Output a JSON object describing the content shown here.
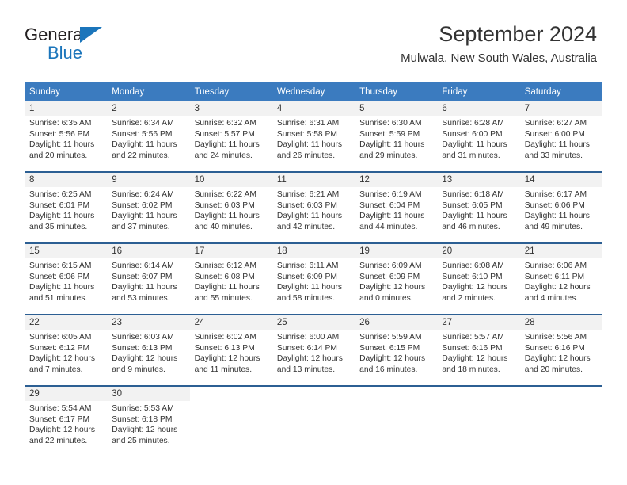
{
  "brand": {
    "name_part1": "General",
    "name_part2": "Blue",
    "accent_color": "#1b75bb"
  },
  "header": {
    "title": "September 2024",
    "subtitle": "Mulwala, New South Wales, Australia"
  },
  "calendar": {
    "header_bg": "#3b7bbf",
    "daynum_bg": "#f2f2f2",
    "weekdays": [
      "Sunday",
      "Monday",
      "Tuesday",
      "Wednesday",
      "Thursday",
      "Friday",
      "Saturday"
    ],
    "weeks": [
      [
        {
          "day": "1",
          "sunrise": "Sunrise: 6:35 AM",
          "sunset": "Sunset: 5:56 PM",
          "daylight_line1": "Daylight: 11 hours",
          "daylight_line2": "and 20 minutes."
        },
        {
          "day": "2",
          "sunrise": "Sunrise: 6:34 AM",
          "sunset": "Sunset: 5:56 PM",
          "daylight_line1": "Daylight: 11 hours",
          "daylight_line2": "and 22 minutes."
        },
        {
          "day": "3",
          "sunrise": "Sunrise: 6:32 AM",
          "sunset": "Sunset: 5:57 PM",
          "daylight_line1": "Daylight: 11 hours",
          "daylight_line2": "and 24 minutes."
        },
        {
          "day": "4",
          "sunrise": "Sunrise: 6:31 AM",
          "sunset": "Sunset: 5:58 PM",
          "daylight_line1": "Daylight: 11 hours",
          "daylight_line2": "and 26 minutes."
        },
        {
          "day": "5",
          "sunrise": "Sunrise: 6:30 AM",
          "sunset": "Sunset: 5:59 PM",
          "daylight_line1": "Daylight: 11 hours",
          "daylight_line2": "and 29 minutes."
        },
        {
          "day": "6",
          "sunrise": "Sunrise: 6:28 AM",
          "sunset": "Sunset: 6:00 PM",
          "daylight_line1": "Daylight: 11 hours",
          "daylight_line2": "and 31 minutes."
        },
        {
          "day": "7",
          "sunrise": "Sunrise: 6:27 AM",
          "sunset": "Sunset: 6:00 PM",
          "daylight_line1": "Daylight: 11 hours",
          "daylight_line2": "and 33 minutes."
        }
      ],
      [
        {
          "day": "8",
          "sunrise": "Sunrise: 6:25 AM",
          "sunset": "Sunset: 6:01 PM",
          "daylight_line1": "Daylight: 11 hours",
          "daylight_line2": "and 35 minutes."
        },
        {
          "day": "9",
          "sunrise": "Sunrise: 6:24 AM",
          "sunset": "Sunset: 6:02 PM",
          "daylight_line1": "Daylight: 11 hours",
          "daylight_line2": "and 37 minutes."
        },
        {
          "day": "10",
          "sunrise": "Sunrise: 6:22 AM",
          "sunset": "Sunset: 6:03 PM",
          "daylight_line1": "Daylight: 11 hours",
          "daylight_line2": "and 40 minutes."
        },
        {
          "day": "11",
          "sunrise": "Sunrise: 6:21 AM",
          "sunset": "Sunset: 6:03 PM",
          "daylight_line1": "Daylight: 11 hours",
          "daylight_line2": "and 42 minutes."
        },
        {
          "day": "12",
          "sunrise": "Sunrise: 6:19 AM",
          "sunset": "Sunset: 6:04 PM",
          "daylight_line1": "Daylight: 11 hours",
          "daylight_line2": "and 44 minutes."
        },
        {
          "day": "13",
          "sunrise": "Sunrise: 6:18 AM",
          "sunset": "Sunset: 6:05 PM",
          "daylight_line1": "Daylight: 11 hours",
          "daylight_line2": "and 46 minutes."
        },
        {
          "day": "14",
          "sunrise": "Sunrise: 6:17 AM",
          "sunset": "Sunset: 6:06 PM",
          "daylight_line1": "Daylight: 11 hours",
          "daylight_line2": "and 49 minutes."
        }
      ],
      [
        {
          "day": "15",
          "sunrise": "Sunrise: 6:15 AM",
          "sunset": "Sunset: 6:06 PM",
          "daylight_line1": "Daylight: 11 hours",
          "daylight_line2": "and 51 minutes."
        },
        {
          "day": "16",
          "sunrise": "Sunrise: 6:14 AM",
          "sunset": "Sunset: 6:07 PM",
          "daylight_line1": "Daylight: 11 hours",
          "daylight_line2": "and 53 minutes."
        },
        {
          "day": "17",
          "sunrise": "Sunrise: 6:12 AM",
          "sunset": "Sunset: 6:08 PM",
          "daylight_line1": "Daylight: 11 hours",
          "daylight_line2": "and 55 minutes."
        },
        {
          "day": "18",
          "sunrise": "Sunrise: 6:11 AM",
          "sunset": "Sunset: 6:09 PM",
          "daylight_line1": "Daylight: 11 hours",
          "daylight_line2": "and 58 minutes."
        },
        {
          "day": "19",
          "sunrise": "Sunrise: 6:09 AM",
          "sunset": "Sunset: 6:09 PM",
          "daylight_line1": "Daylight: 12 hours",
          "daylight_line2": "and 0 minutes."
        },
        {
          "day": "20",
          "sunrise": "Sunrise: 6:08 AM",
          "sunset": "Sunset: 6:10 PM",
          "daylight_line1": "Daylight: 12 hours",
          "daylight_line2": "and 2 minutes."
        },
        {
          "day": "21",
          "sunrise": "Sunrise: 6:06 AM",
          "sunset": "Sunset: 6:11 PM",
          "daylight_line1": "Daylight: 12 hours",
          "daylight_line2": "and 4 minutes."
        }
      ],
      [
        {
          "day": "22",
          "sunrise": "Sunrise: 6:05 AM",
          "sunset": "Sunset: 6:12 PM",
          "daylight_line1": "Daylight: 12 hours",
          "daylight_line2": "and 7 minutes."
        },
        {
          "day": "23",
          "sunrise": "Sunrise: 6:03 AM",
          "sunset": "Sunset: 6:13 PM",
          "daylight_line1": "Daylight: 12 hours",
          "daylight_line2": "and 9 minutes."
        },
        {
          "day": "24",
          "sunrise": "Sunrise: 6:02 AM",
          "sunset": "Sunset: 6:13 PM",
          "daylight_line1": "Daylight: 12 hours",
          "daylight_line2": "and 11 minutes."
        },
        {
          "day": "25",
          "sunrise": "Sunrise: 6:00 AM",
          "sunset": "Sunset: 6:14 PM",
          "daylight_line1": "Daylight: 12 hours",
          "daylight_line2": "and 13 minutes."
        },
        {
          "day": "26",
          "sunrise": "Sunrise: 5:59 AM",
          "sunset": "Sunset: 6:15 PM",
          "daylight_line1": "Daylight: 12 hours",
          "daylight_line2": "and 16 minutes."
        },
        {
          "day": "27",
          "sunrise": "Sunrise: 5:57 AM",
          "sunset": "Sunset: 6:16 PM",
          "daylight_line1": "Daylight: 12 hours",
          "daylight_line2": "and 18 minutes."
        },
        {
          "day": "28",
          "sunrise": "Sunrise: 5:56 AM",
          "sunset": "Sunset: 6:16 PM",
          "daylight_line1": "Daylight: 12 hours",
          "daylight_line2": "and 20 minutes."
        }
      ],
      [
        {
          "day": "29",
          "sunrise": "Sunrise: 5:54 AM",
          "sunset": "Sunset: 6:17 PM",
          "daylight_line1": "Daylight: 12 hours",
          "daylight_line2": "and 22 minutes."
        },
        {
          "day": "30",
          "sunrise": "Sunrise: 5:53 AM",
          "sunset": "Sunset: 6:18 PM",
          "daylight_line1": "Daylight: 12 hours",
          "daylight_line2": "and 25 minutes."
        },
        {
          "day": "",
          "sunrise": "",
          "sunset": "",
          "daylight_line1": "",
          "daylight_line2": ""
        },
        {
          "day": "",
          "sunrise": "",
          "sunset": "",
          "daylight_line1": "",
          "daylight_line2": ""
        },
        {
          "day": "",
          "sunrise": "",
          "sunset": "",
          "daylight_line1": "",
          "daylight_line2": ""
        },
        {
          "day": "",
          "sunrise": "",
          "sunset": "",
          "daylight_line1": "",
          "daylight_line2": ""
        },
        {
          "day": "",
          "sunrise": "",
          "sunset": "",
          "daylight_line1": "",
          "daylight_line2": ""
        }
      ]
    ]
  }
}
